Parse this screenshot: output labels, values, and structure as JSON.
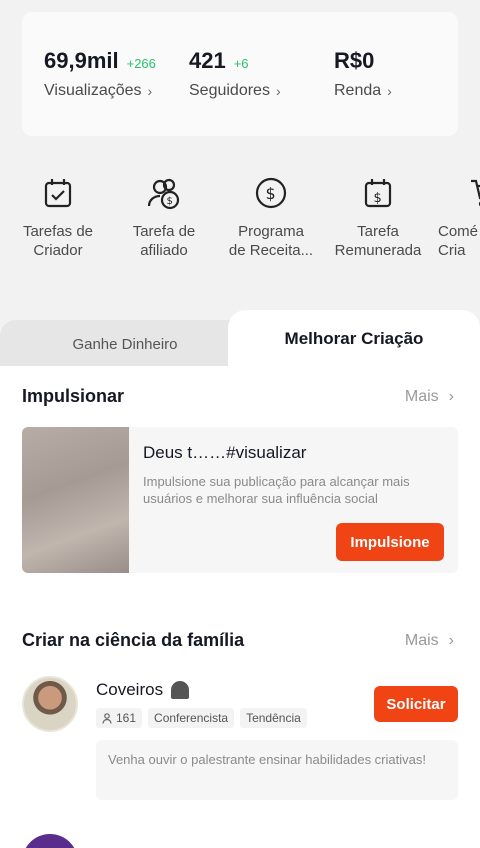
{
  "stats": [
    {
      "value": "69,9mil",
      "delta": "+266",
      "label": "Visualizações"
    },
    {
      "value": "421",
      "delta": "+6",
      "label": "Seguidores"
    },
    {
      "value": "R$0",
      "delta": "",
      "label": "Renda"
    }
  ],
  "tools": [
    {
      "icon": "calendar-check-icon",
      "label": "Tarefas de\nCriador"
    },
    {
      "icon": "people-dollar-icon",
      "label": "Tarefa de\nafiliado"
    },
    {
      "icon": "dollar-circle-icon",
      "label": "Programa\nde Receita..."
    },
    {
      "icon": "calendar-dollar-icon",
      "label": "Tarefa\nRemunerada"
    },
    {
      "icon": "cart-icon",
      "label": "Comé\nCria"
    }
  ],
  "tabs": {
    "left": "Ganhe Dinheiro",
    "right": "Melhorar Criação"
  },
  "boost": {
    "title": "Impulsionar",
    "more": "Mais",
    "card_title": "Deus t……#visualizar",
    "card_desc": "Impulsione sua publicação para alcançar mais usuários e melhorar sua influência social",
    "button": "Impulsione"
  },
  "science": {
    "title": "Criar na ciência da família",
    "more": "Mais",
    "creator": {
      "name": "Coveiros",
      "followers": "161",
      "tags": [
        "Conferencista",
        "Tendência"
      ],
      "button": "Solicitar",
      "desc": "Venha ouvir o palestrante ensinar habilidades criativas!"
    },
    "next_name": "……"
  },
  "colors": {
    "accent": "#f04414",
    "positive": "#25c36b"
  }
}
